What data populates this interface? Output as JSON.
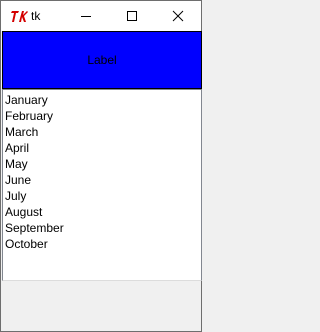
{
  "window": {
    "title": "tk",
    "icon": "tk-feather-icon"
  },
  "label": {
    "text": "Label",
    "background": "#0000ff"
  },
  "listbox": {
    "items": [
      "January",
      "February",
      "March",
      "April",
      "May",
      "June",
      "July",
      "August",
      "September",
      "October"
    ]
  },
  "colors": {
    "titlebar": "#ffffff",
    "window_bg": "#f0f0f0",
    "label_bg": "#0000ff"
  }
}
